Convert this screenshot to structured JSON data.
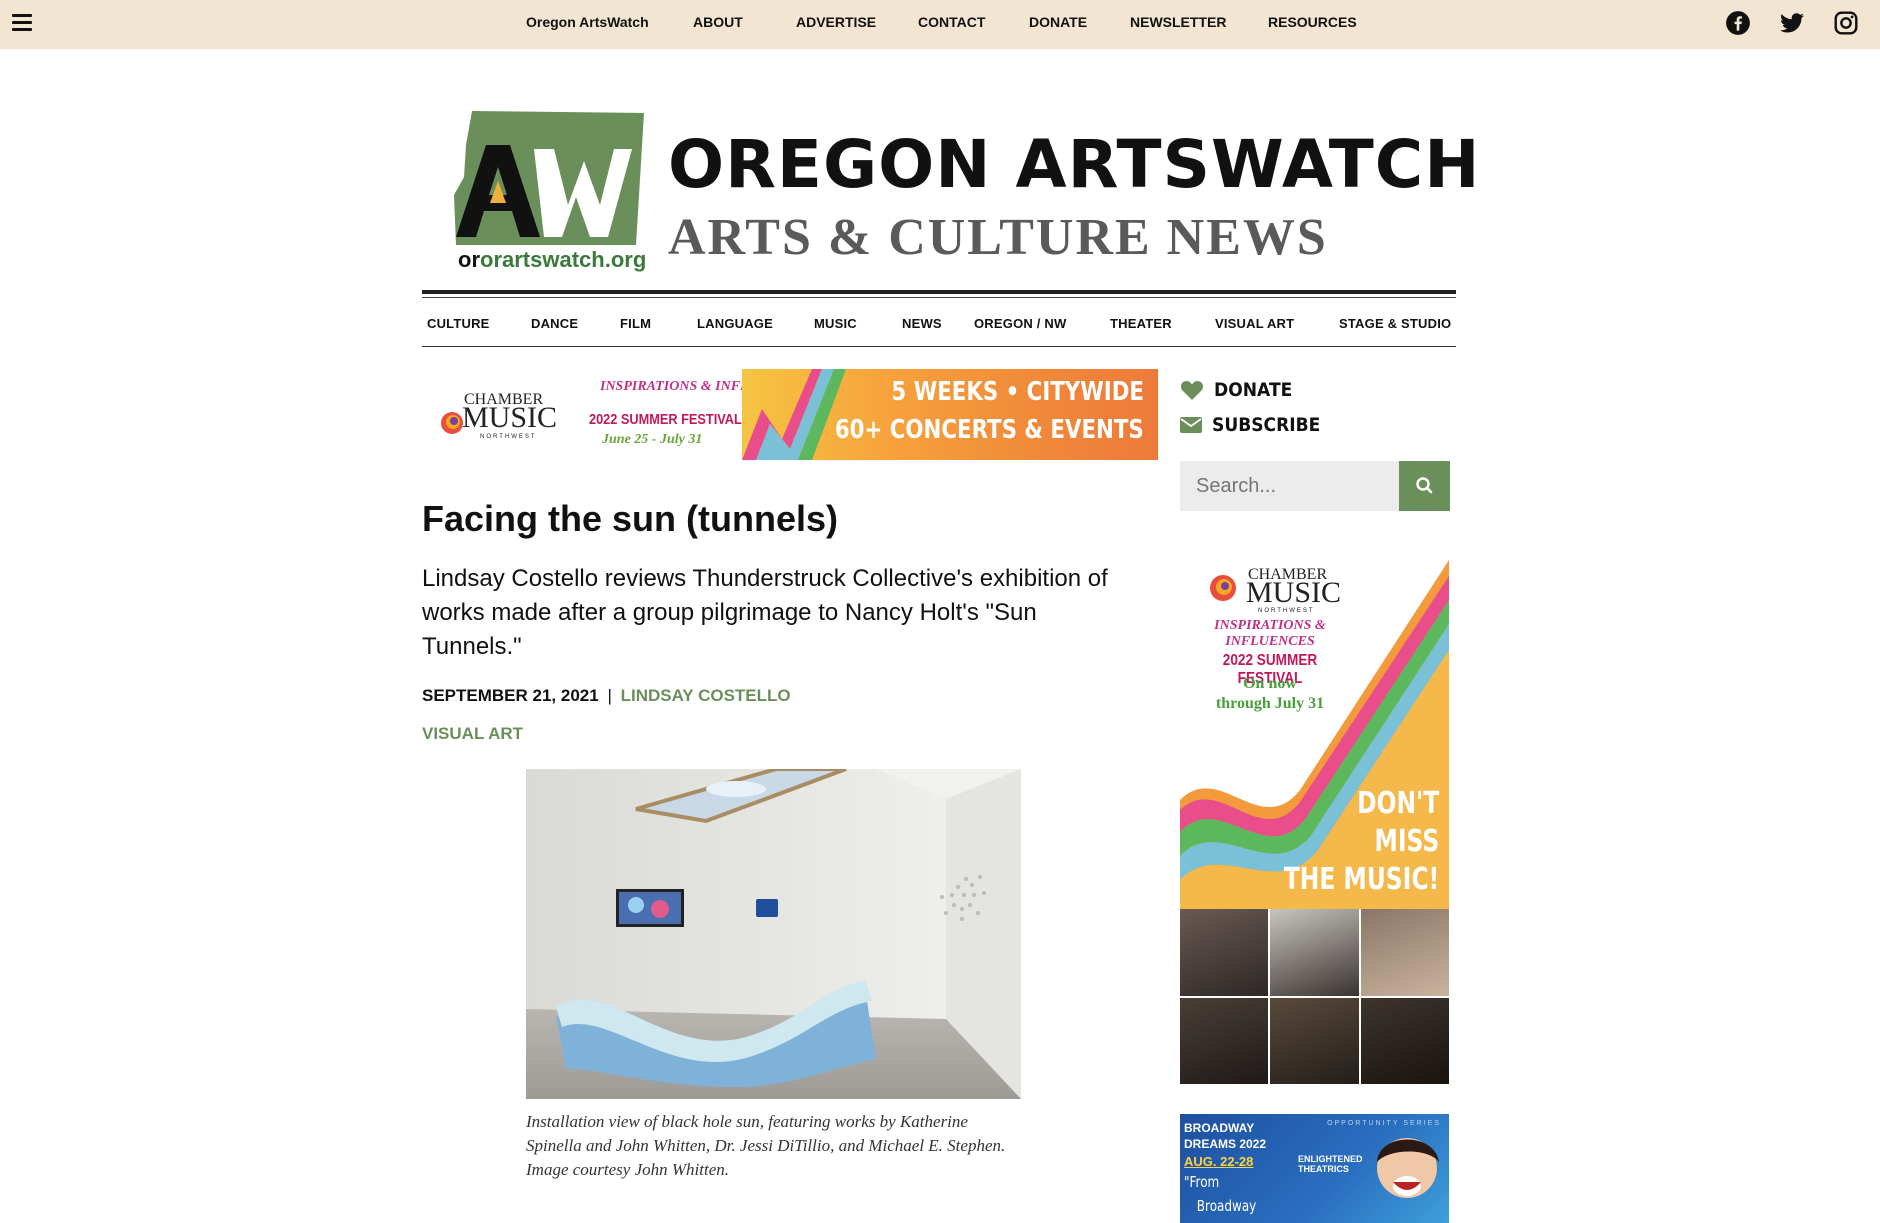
{
  "topbar": {
    "site_name": "Oregon ArtsWatch",
    "links": [
      "ABOUT",
      "ADVERTISE",
      "CONTACT",
      "DONATE",
      "NEWSLETTER",
      "RESOURCES"
    ],
    "social": [
      "facebook-icon",
      "twitter-icon",
      "instagram-icon"
    ]
  },
  "logo": {
    "title": "OREGON ARTSWATCH",
    "subtitle": "ARTS & CULTURE NEWS",
    "mark_letters": "AW",
    "url_text": "orartswatch.org"
  },
  "categories": [
    "CULTURE",
    "DANCE",
    "FILM",
    "LANGUAGE",
    "MUSIC",
    "NEWS",
    "OREGON / NW",
    "THEATER",
    "VISUAL ART",
    "STAGE & STUDIO"
  ],
  "banner_ad": {
    "org_line1": "CHAMBER",
    "org_line2": "MUSIC",
    "org_line3": "NORTHWEST",
    "festival_line1": "INSPIRATIONS & INFLUENCES",
    "festival_line2": "2022 SUMMER FESTIVAL",
    "festival_dates": "June 25 - July 31",
    "headline1": "5 WEEKS • CITYWIDE",
    "headline2": "60+ CONCERTS & EVENTS"
  },
  "sidebar": {
    "donate_label": "DONATE",
    "subscribe_label": "SUBSCRIBE",
    "search_placeholder": "Search...",
    "ad1": {
      "org_line1": "CHAMBER",
      "org_line2": "MUSIC",
      "org_line3": "NORTHWEST",
      "festival_line1": "INSPIRATIONS & INFLUENCES",
      "festival_line2": "2022 SUMMER FESTIVAL",
      "on_now": "On now",
      "through": "through July 31",
      "dont": "DON'T",
      "miss": "MISS",
      "the_music": "THE MUSIC!"
    },
    "ad2": {
      "line1": "BROADWAY",
      "line2": "DREAMS 2022",
      "series": "OPPORTUNITY SERIES",
      "dates": "AUG. 22-28",
      "quote1": "\"From",
      "quote2": "Broadway",
      "producer": "ENLIGHTENED THEATRICS"
    }
  },
  "article": {
    "title": "Facing the sun (tunnels)",
    "dek": "Lindsay Costello reviews Thunderstruck Collective's exhibition of works made after a group pilgrimage to Nancy Holt's \"Sun Tunnels.\"",
    "date": "SEPTEMBER 21, 2021",
    "separator": "|",
    "author": "LINDSAY COSTELLO",
    "category": "VISUAL ART",
    "caption": "Installation view of black hole sun, featuring works by Katherine Spinella and John Whitten, Dr. Jessi DiTillio, and Michael E. Stephen. Image courtesy John Whitten."
  },
  "colors": {
    "topbar_bg": "#f2e6d3",
    "accent_green": "#6b8f5a",
    "search_bg": "#ececec"
  }
}
